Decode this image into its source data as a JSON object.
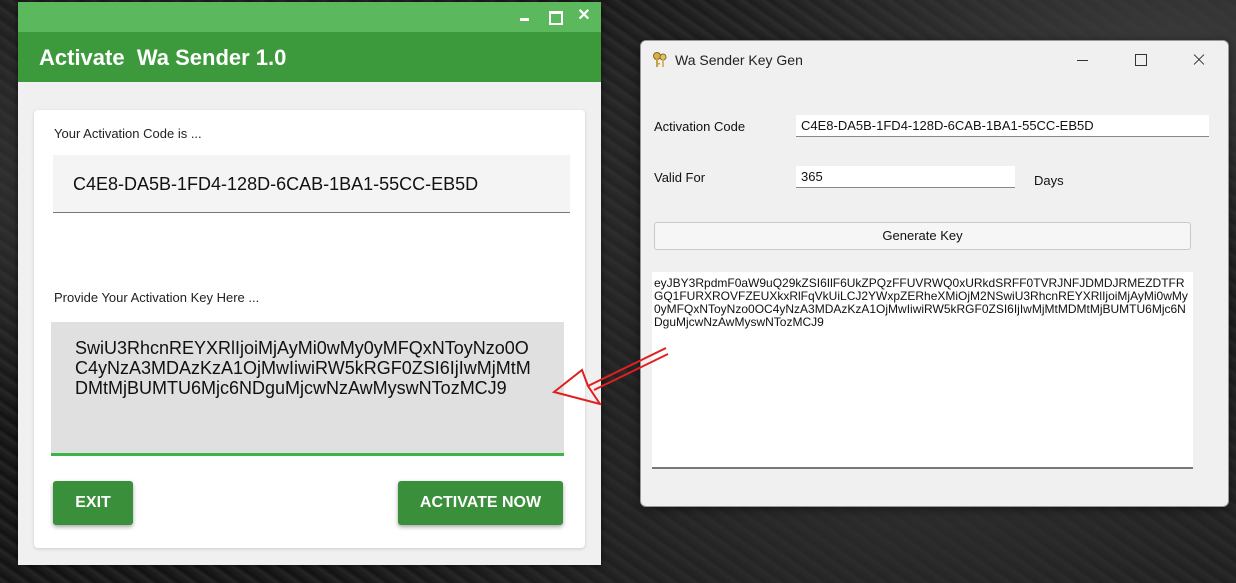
{
  "activation_window": {
    "title": "Activate  Wa Sender 1.0",
    "controls": {
      "close_glyph": "✕"
    },
    "code_label": "Your Activation Code is ...",
    "activation_code": "C4E8-DA5B-1FD4-128D-6CAB-1BA1-55CC-EB5D",
    "key_label": "Provide Your Activation Key Here ...",
    "activation_key": "SwiU3RhcnREYXRlIjoiMjAyMi0wMy0yMFQxNToyNzo0OC4yNzA3MDAzKzA1OjMwIiwiRW5kRGF0ZSI6IjIwMjMtMDMtMjBUMTU6Mjc6NDguMjcwNzAwMyswNTozMCJ9",
    "exit_label": "EXIT",
    "activate_label": "ACTIVATE NOW",
    "accent_color": "#3c9a3c",
    "titlebar_color": "#5cb85c"
  },
  "keygen_window": {
    "title": "Wa Sender Key Gen",
    "app_icon": "keys-icon",
    "activation_code_label": "Activation Code",
    "activation_code_value": "C4E8-DA5B-1FD4-128D-6CAB-1BA1-55CC-EB5D",
    "valid_for_label": "Valid For",
    "valid_for_value": "365",
    "days_label": "Days",
    "generate_label": "Generate Key",
    "generated_key": "eyJBY3RpdmF0aW9uQ29kZSI6IlF6UkZPQzFFUVRWQ0xURkdSRFF0TVRJNFJDMDJRMEZDTFRGQ1FURXROVFZEUXkxRlFqVkUiLCJ2YWxpZERheXMiOjM2NSwiU3RhcnREYXRlIjoiMjAyMi0wMy0yMFQxNToyNzo0OC4yNzA3MDAzKzA1OjMwIiwiRW5kRGF0ZSI6IjIwMjMtMDMtMjBUMTU6Mjc6NDguMjcwNzAwMyswNTozMCJ9"
  },
  "annotation": {
    "arrow_color": "#e02020"
  }
}
